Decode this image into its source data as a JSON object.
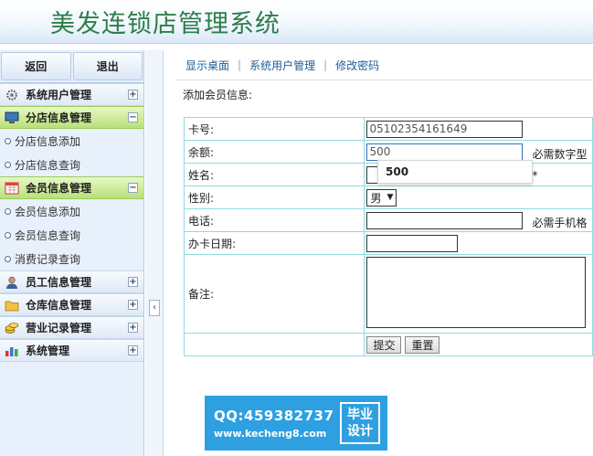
{
  "app": {
    "title": "美发连锁店管理系统"
  },
  "sidebar": {
    "top_buttons": [
      "返回",
      "退出"
    ],
    "groups": [
      {
        "label": "系统用户管理",
        "icon": "gear-icon",
        "toggle": "+"
      },
      {
        "label": "分店信息管理",
        "icon": "monitor-icon",
        "toggle": "−",
        "items": [
          "分店信息添加",
          "分店信息查询"
        ]
      },
      {
        "label": "会员信息管理",
        "icon": "calendar-icon",
        "toggle": "−",
        "items": [
          "会员信息添加",
          "会员信息查询",
          "消费记录查询"
        ]
      },
      {
        "label": "员工信息管理",
        "icon": "user-icon",
        "toggle": "+"
      },
      {
        "label": "仓库信息管理",
        "icon": "folder-icon",
        "toggle": "+"
      },
      {
        "label": "营业记录管理",
        "icon": "coins-icon",
        "toggle": "+"
      },
      {
        "label": "系统管理",
        "icon": "bar-chart-icon",
        "toggle": "+"
      }
    ],
    "collapse_glyph": "‹"
  },
  "topnav": {
    "links": [
      "显示桌面",
      "系统用户管理",
      "修改密码"
    ]
  },
  "form": {
    "section_title": "添加会员信息:",
    "card_label": "卡号:",
    "card_value": "05102354161649",
    "balance_label": "余额:",
    "balance_value": "500",
    "balance_hint": "必需数字型",
    "name_label": "姓名:",
    "name_required": "*",
    "gender_label": "性别:",
    "gender_value": "男",
    "phone_label": "电话:",
    "phone_hint": "必需手机格",
    "date_label": "办卡日期:",
    "notes_label": "备注:",
    "submit_label": "提交",
    "reset_label": "重置",
    "autocomplete_value": "500"
  },
  "watermark": {
    "qq": "QQ:459382737",
    "url": "www.kecheng8.com",
    "badge_line1": "毕业",
    "badge_line2": "设计"
  },
  "colors": {
    "active_group": "#b8e07a",
    "title_green": "#2e7d4a",
    "link_blue": "#1f5d99",
    "table_border": "#8fdce0",
    "watermark_bg": "#2e9fe0"
  }
}
